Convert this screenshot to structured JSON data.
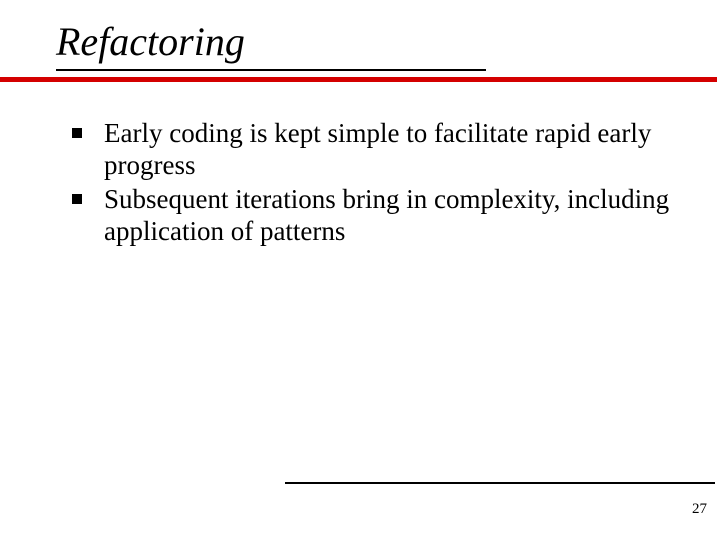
{
  "slide": {
    "title": "Refactoring",
    "bullets": [
      "Early coding is kept simple to facilitate rapid early progress",
      "Subsequent iterations bring in complexity, including application of patterns"
    ],
    "page_number": "27"
  }
}
